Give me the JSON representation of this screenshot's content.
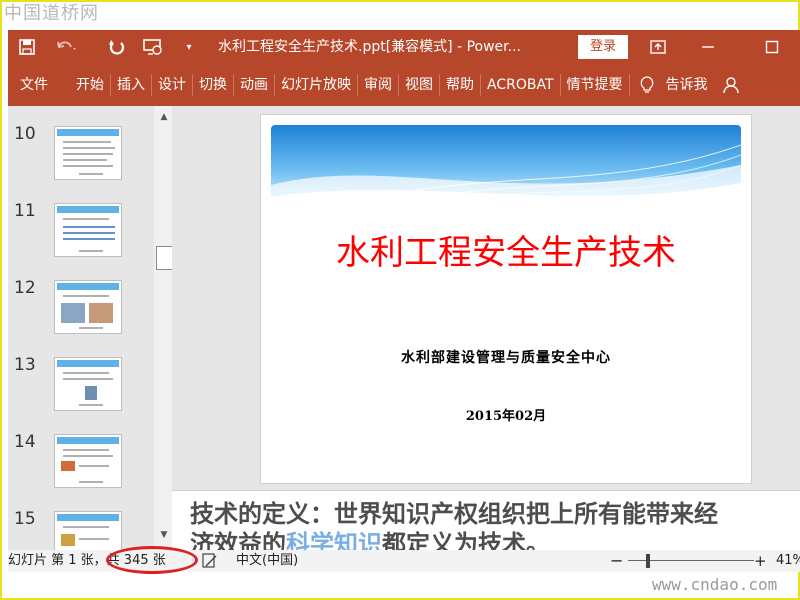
{
  "watermarks": {
    "top": "中国道桥网",
    "bottom": "www.cndao.com"
  },
  "titlebar": {
    "title": "水利工程安全生产技术.ppt[兼容模式] - Power...",
    "login_label": "登录",
    "accent": "#b7472a"
  },
  "menu": {
    "items": [
      "文件",
      "开始",
      "插入",
      "设计",
      "切换",
      "动画",
      "幻灯片放映",
      "审阅",
      "视图",
      "帮助",
      "ACROBAT",
      "情节提要"
    ],
    "tell_me": "告诉我"
  },
  "thumbnails": [
    {
      "number": "10"
    },
    {
      "number": "11"
    },
    {
      "number": "12"
    },
    {
      "number": "13"
    },
    {
      "number": "14"
    },
    {
      "number": "15"
    }
  ],
  "slide": {
    "title": "水利工程安全生产技术",
    "organization": "水利部建设管理与质量安全中心",
    "date": "2015年02月",
    "title_color": "#ff0000"
  },
  "notes": {
    "line1": "技术的定义：世界知识产权组织把上所有能带来经",
    "line2_pre": "济效益的",
    "line2_hl": "科学知识",
    "line2_post": "都定义为技术。"
  },
  "status": {
    "slide_info": "幻灯片 第 1 张，共 345 张",
    "language": "中文(中国)",
    "zoom_minus": "−",
    "zoom_plus": "+",
    "zoom_value": "41%"
  }
}
